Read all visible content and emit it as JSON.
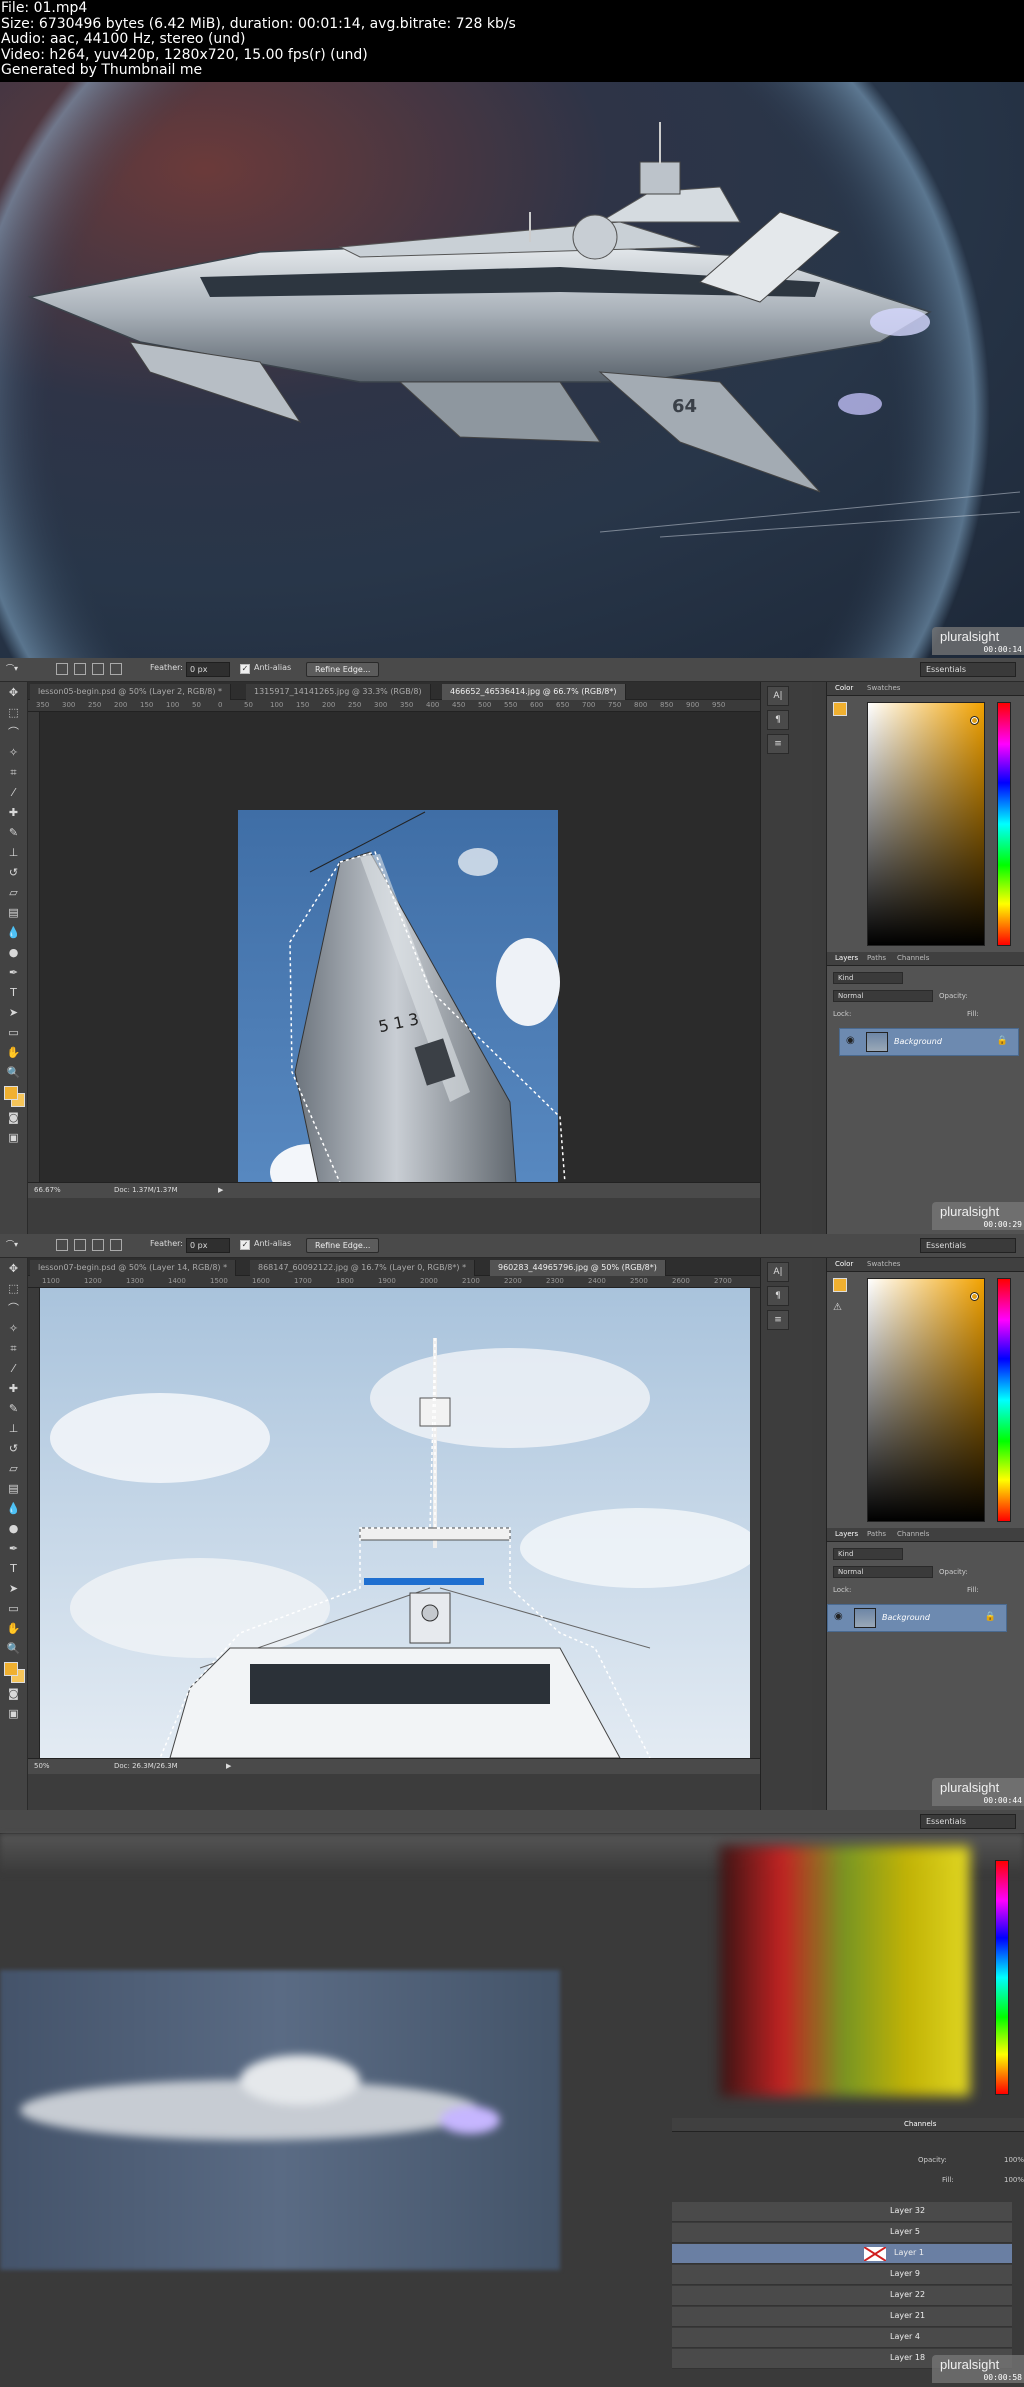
{
  "header": {
    "lines": [
      "File: 01.mp4",
      "Size: 6730496 bytes (6.42 MiB), duration: 00:01:14, avg.bitrate: 728 kb/s",
      "Audio: aac, 44100 Hz, stereo (und)",
      "Video: h264, yuv420p, 1280x720, 15.00 fps(r) (und)",
      "Generated by Thumbnail me"
    ]
  },
  "watermark": {
    "brand": "pluralsight"
  },
  "timestamps": [
    "00:00:14",
    "00:00:29",
    "00:00:44",
    "00:00:58"
  ],
  "ship_label": "64",
  "options_bar": {
    "feather_label": "Feather:",
    "feather_value": "0 px",
    "antialias_label": "Anti-alias",
    "refine_label": "Refine Edge...",
    "workspace": "Essentials"
  },
  "frame2": {
    "tabs": [
      "lesson05-begin.psd @ 50% (Layer 2, RGB/8) *",
      "1315917_14141265.jpg @ 33.3% (RGB/8)",
      "466652_46536414.jpg @ 66.7% (RGB/8*)"
    ],
    "ruler": [
      "350",
      "300",
      "250",
      "200",
      "150",
      "100",
      "50",
      "0",
      "50",
      "100",
      "150",
      "200",
      "250",
      "300",
      "350",
      "400",
      "450",
      "500",
      "550",
      "600",
      "650",
      "700",
      "750",
      "800",
      "850",
      "900",
      "950"
    ],
    "zoom": "66.67%",
    "doc": "Doc: 1.37M/1.37M",
    "rocket_label": "5 1 3",
    "layer_name": "Background"
  },
  "frame3": {
    "tabs": [
      "lesson07-begin.psd @ 50% (Layer 14, RGB/8) *",
      "868147_60092122.jpg @ 16.7% (Layer 0, RGB/8*) *",
      "960283_44965796.jpg @ 50% (RGB/8*)"
    ],
    "ruler": [
      "1100",
      "1200",
      "1300",
      "1400",
      "1500",
      "1600",
      "1700",
      "1800",
      "1900",
      "2000",
      "2100",
      "2200",
      "2300",
      "2400",
      "2500",
      "2600",
      "2700"
    ],
    "zoom": "50%",
    "doc": "Doc: 26.3M/26.3M",
    "layer_name": "Background"
  },
  "panels": {
    "color_tabs": [
      "Color",
      "Swatches"
    ],
    "layers_tabs": [
      "Layers",
      "Paths",
      "Channels"
    ],
    "kind_label": "Kind",
    "blend_mode": "Normal",
    "opacity_label": "Opacity:",
    "lock_label": "Lock:",
    "fill_label": "Fill:"
  },
  "frame4": {
    "layers_tabs": [
      "Channels"
    ],
    "opacity_label": "Opacity:",
    "opacity_value": "100%",
    "fill_label": "Fill:",
    "fill_value": "100%",
    "layers": [
      "Layer 32",
      "Layer 5",
      "Layer 1",
      "Layer 9",
      "Layer 22",
      "Layer 21",
      "Layer 4",
      "Layer 18"
    ],
    "selected_layer": "Layer 1"
  },
  "colors": {
    "foreground": "#f0b030",
    "selected_layer": "#6d8ab0",
    "accent_selection": "#1f6fd0"
  }
}
